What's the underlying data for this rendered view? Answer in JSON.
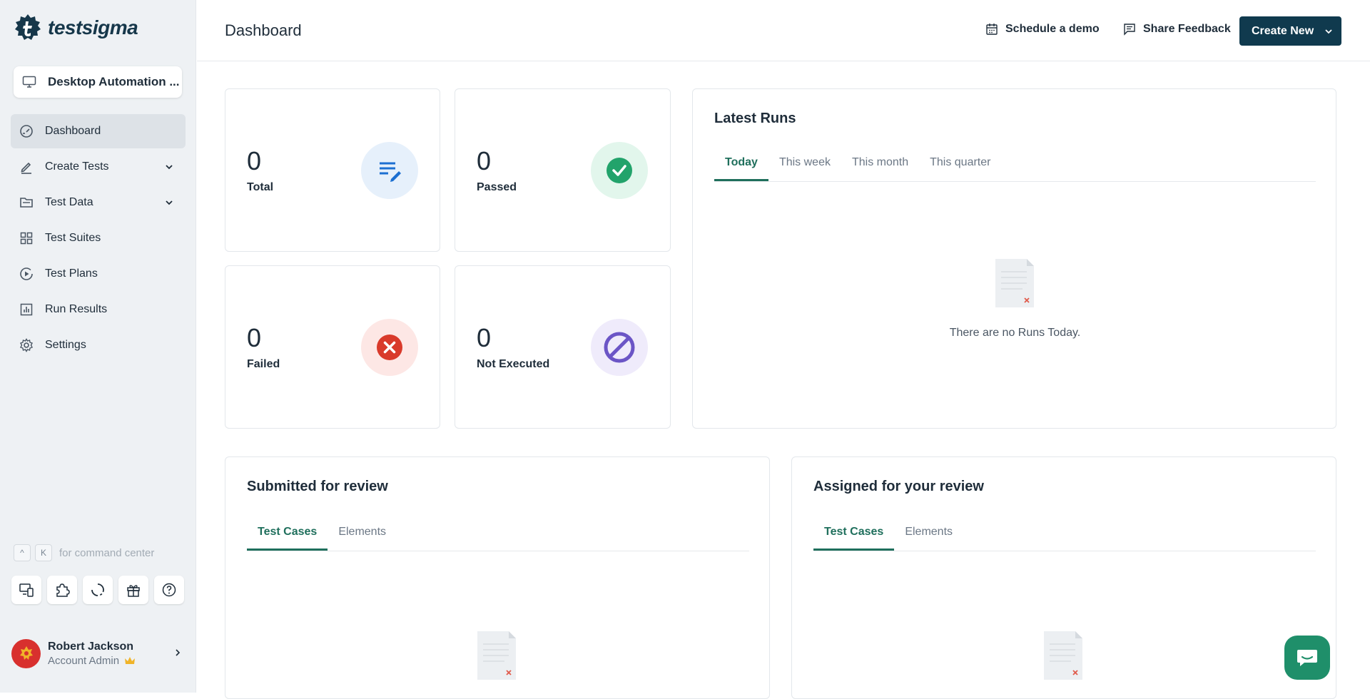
{
  "app": {
    "logo_text": "testsigma"
  },
  "sidebar": {
    "workspace_label": "Desktop Automation ...",
    "items": [
      {
        "label": "Dashboard",
        "icon": "gauge-icon",
        "active": true
      },
      {
        "label": "Create Tests",
        "icon": "pencil-icon",
        "expandable": true
      },
      {
        "label": "Test Data",
        "icon": "folder-icon",
        "expandable": true
      },
      {
        "label": "Test Suites",
        "icon": "grid-icon"
      },
      {
        "label": "Test Plans",
        "icon": "play-circle-icon"
      },
      {
        "label": "Run Results",
        "icon": "bar-chart-icon"
      },
      {
        "label": "Settings",
        "icon": "gear-icon"
      }
    ],
    "command": {
      "key1": "^",
      "key2": "K",
      "text": "for command center"
    },
    "tools": [
      "desktop-mobile-icon",
      "puzzle-icon",
      "refresh-icon",
      "gift-icon",
      "help-icon"
    ],
    "user": {
      "name": "Robert Jackson",
      "role": "Account Admin"
    }
  },
  "header": {
    "title": "Dashboard",
    "schedule_demo": "Schedule a demo",
    "share_feedback": "Share Feedback",
    "create_new": "Create New"
  },
  "stats": {
    "total": {
      "value": "0",
      "label": "Total"
    },
    "passed": {
      "value": "0",
      "label": "Passed"
    },
    "failed": {
      "value": "0",
      "label": "Failed"
    },
    "not_executed": {
      "value": "0",
      "label": "Not Executed"
    }
  },
  "latest_runs": {
    "title": "Latest Runs",
    "tabs": [
      "Today",
      "This week",
      "This month",
      "This quarter"
    ],
    "empty_text": "There are no Runs Today."
  },
  "submitted_review": {
    "title": "Submitted for review",
    "tabs": [
      "Test Cases",
      "Elements"
    ]
  },
  "assigned_review": {
    "title": "Assigned for your review",
    "tabs": [
      "Test Cases",
      "Elements"
    ]
  },
  "colors": {
    "brand": "#103a4e",
    "accent": "#1f6f5c",
    "passed": "#22a36b",
    "failed": "#d93a2b",
    "not_executed": "#6b55c6",
    "total": "#1c6fd1"
  }
}
